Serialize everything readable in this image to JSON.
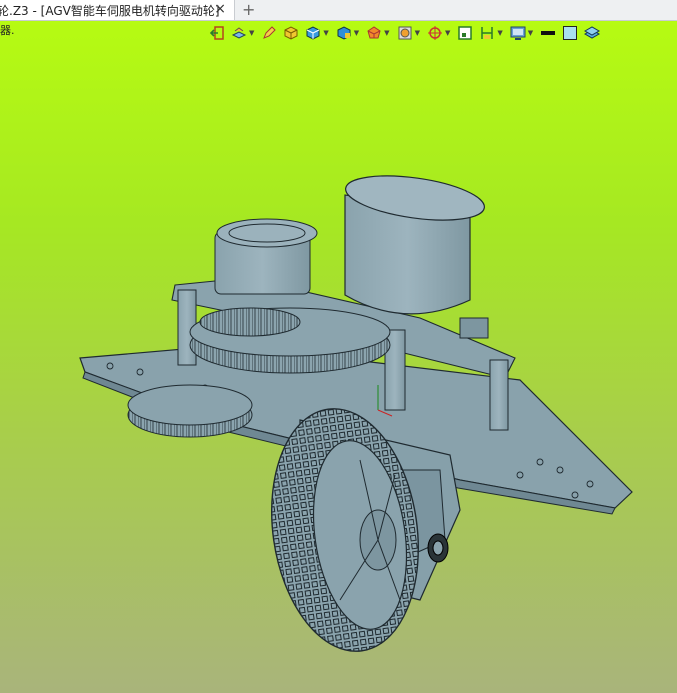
{
  "tab": {
    "title": "Z3 - [AGV智能车伺服电机转向驱动轮]",
    "prefix": "轮.",
    "close_icon": "×",
    "new_tab_icon": "+"
  },
  "status": {
    "left_text": "器."
  },
  "toolbar": {
    "icons": [
      "exit-icon",
      "layers-icon",
      "pencil-icon",
      "shaded-box-icon",
      "box-view-icon",
      "box-view-2-icon",
      "render-mode-icon",
      "camera-icon",
      "target-icon",
      "frame-icon",
      "dimension-icon",
      "display-settings-icon",
      "line-color-icon",
      "fill-color-icon",
      "layer-icon"
    ]
  },
  "colors": {
    "viewport_top": "#b6fb12",
    "viewport_bottom": "#a9b47b",
    "model_metal": "#8aa3ad",
    "model_edge": "#1f2a30"
  }
}
